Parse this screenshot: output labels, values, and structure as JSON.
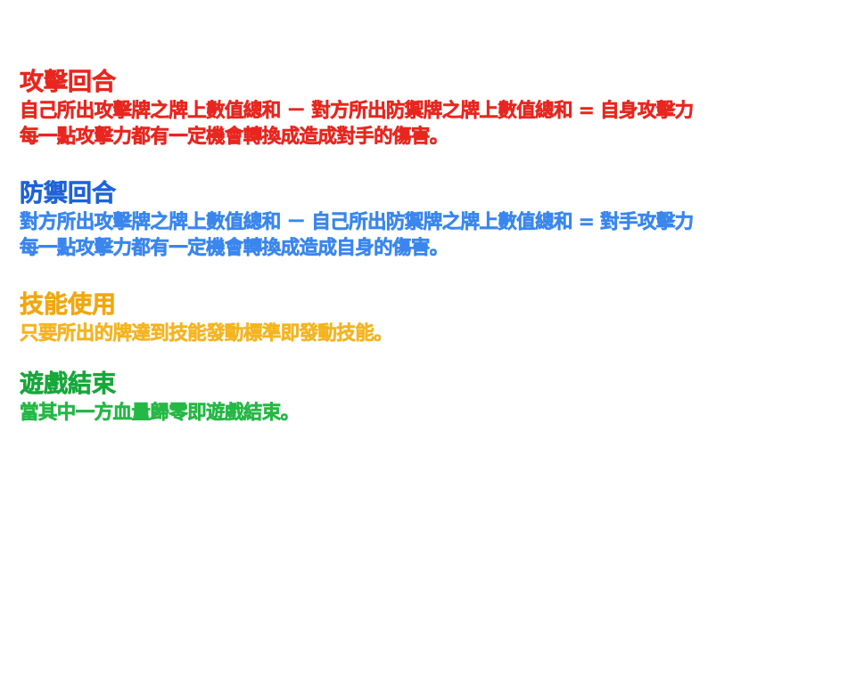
{
  "rules": {
    "attack": {
      "title": "攻擊回合",
      "lines": [
        "自己所出攻擊牌之牌上數值總和 － 對方所出防禦牌之牌上數值總和 = 自身攻擊力",
        "每一點攻擊力都有一定機會轉換成造成對手的傷害。"
      ],
      "color": "#e8261f"
    },
    "defense": {
      "title": "防禦回合",
      "lines": [
        "對方所出攻擊牌之牌上數值總和 － 自己所出防禦牌之牌上數值總和 = 對手攻擊力",
        "每一點攻擊力都有一定機會轉換成造成自身的傷害。"
      ],
      "color": "#3a86ee"
    },
    "skill": {
      "title": "技能使用",
      "lines": [
        "只要所出的牌達到技能發動標準即發動技能。"
      ],
      "color": "#f4b422"
    },
    "end": {
      "title": "遊戲結束",
      "lines": [
        "當其中一方血量歸零即遊戲結束。"
      ],
      "color": "#25b845"
    }
  }
}
